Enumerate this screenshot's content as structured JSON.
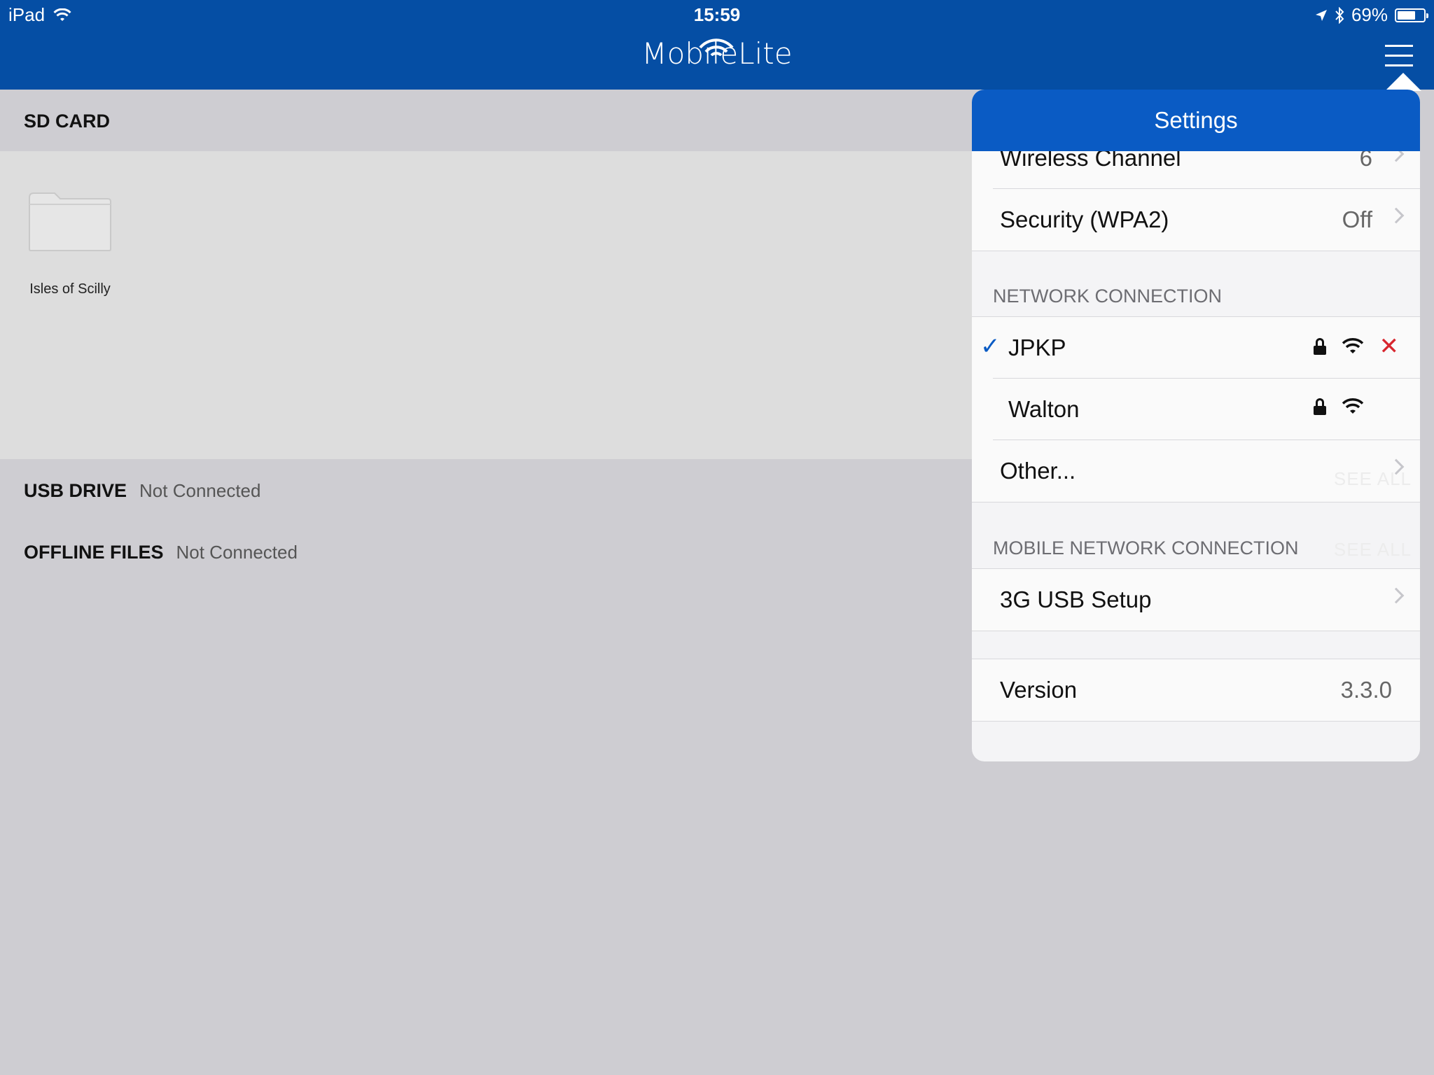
{
  "status_bar": {
    "device": "iPad",
    "time": "15:59",
    "battery": "69%",
    "battery_level": 0.69
  },
  "nav": {
    "logo": "MobileLite",
    "menu_icon": "hamburger-menu-icon"
  },
  "sd_card": {
    "title": "SD CARD",
    "items": [
      {
        "label": "Isles of Scilly",
        "icon": "folder-icon"
      }
    ]
  },
  "usb_drive": {
    "title": "USB DRIVE",
    "status": "Not Connected"
  },
  "offline_files": {
    "title": "OFFLINE FILES",
    "status": "Not Connected"
  },
  "settings": {
    "title": "Settings",
    "rows_top": [
      {
        "label": "Wireless Channel",
        "value": "6"
      },
      {
        "label": "Security (WPA2)",
        "value": "Off"
      }
    ],
    "network_connection": {
      "title": "NETWORK CONNECTION",
      "networks": [
        {
          "name": "JPKP",
          "selected": true,
          "locked": true
        },
        {
          "name": "Walton",
          "selected": false,
          "locked": true
        }
      ],
      "other_label": "Other..."
    },
    "mobile_network": {
      "title": "MOBILE NETWORK CONNECTION",
      "setup_label": "3G USB Setup"
    },
    "version": {
      "label": "Version",
      "value": "3.3.0"
    },
    "ghost_text": "SEE ALL"
  },
  "colors": {
    "nav_blue": "#054ea4",
    "popover_header_blue": "#0a5bc4",
    "checkmark_blue": "#0a5bc4",
    "disconnect_red": "#d8262e",
    "background_gray": "#cecdd2"
  }
}
